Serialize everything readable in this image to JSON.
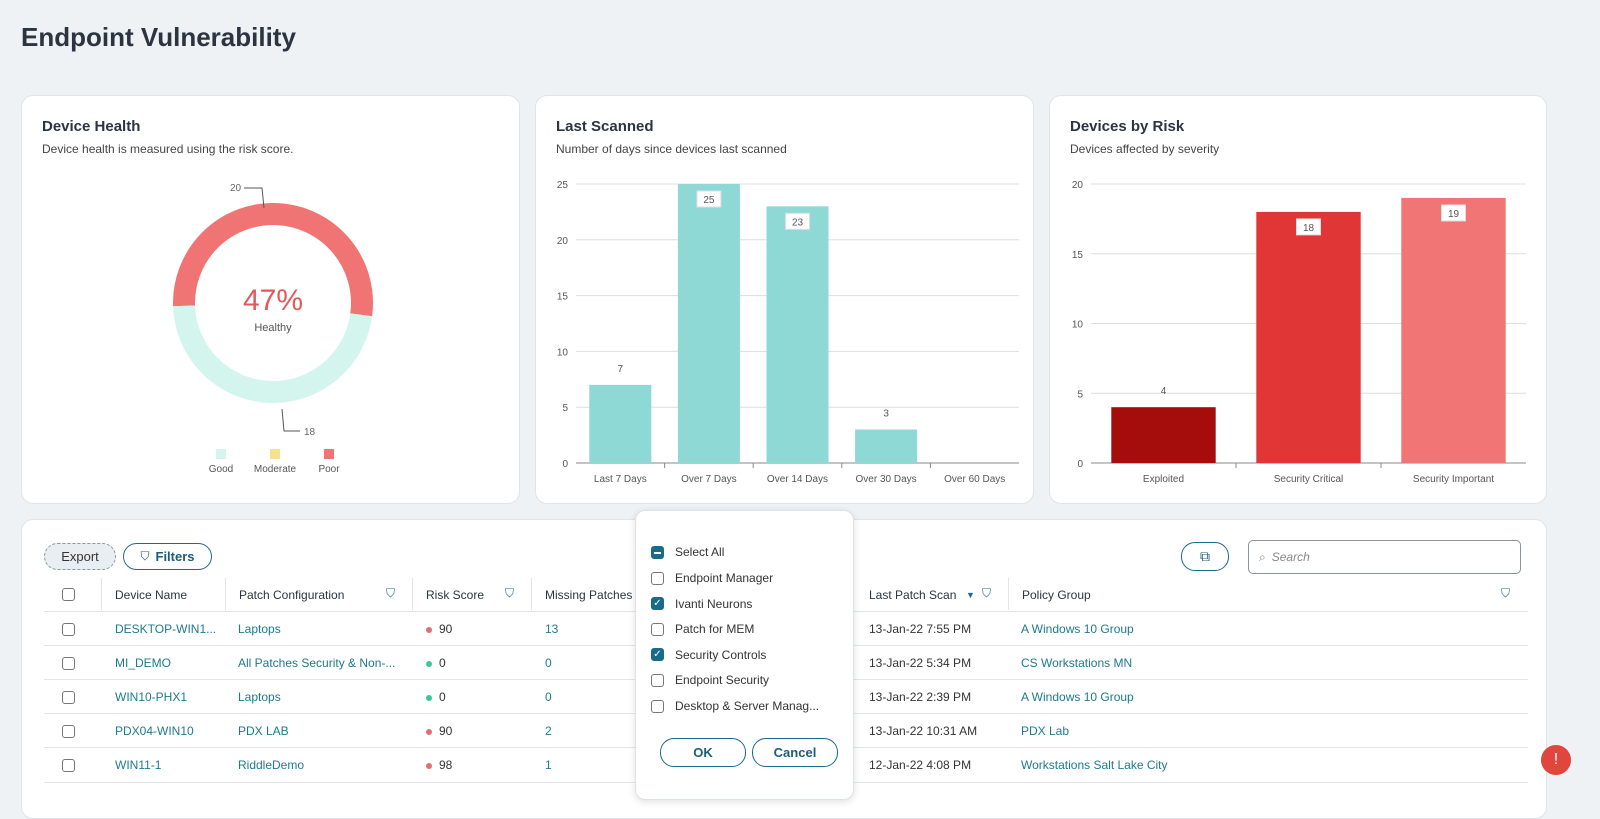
{
  "page": {
    "title": "Endpoint Vulnerability"
  },
  "device_health": {
    "title": "Device Health",
    "subtitle": "Device health is measured using the risk score.",
    "center_value": "47%",
    "center_label": "Healthy",
    "legend": [
      "Good",
      "Moderate",
      "Poor"
    ],
    "colors": {
      "Good": "#d4f5ee",
      "Moderate": "#f7e08c",
      "Poor": "#f07474"
    }
  },
  "last_scanned": {
    "title": "Last Scanned",
    "subtitle": "Number of days since devices last scanned"
  },
  "devices_by_risk": {
    "title": "Devices by Risk",
    "subtitle": "Devices affected by severity"
  },
  "chart_data": [
    {
      "type": "pie",
      "slices": [
        {
          "label": "Good",
          "value": 18
        },
        {
          "label": "Moderate",
          "value": 0
        },
        {
          "label": "Poor",
          "value": 20
        }
      ]
    },
    {
      "type": "bar",
      "categories": [
        "Last 7 Days",
        "Over 7 Days",
        "Over 14 Days",
        "Over 30 Days",
        "Over 60 Days"
      ],
      "values": [
        7,
        25,
        23,
        3,
        0
      ],
      "ylim": [
        0,
        25
      ],
      "yticks": [
        0,
        5,
        10,
        15,
        20,
        25
      ],
      "grid": true,
      "color": "#8ed9d6"
    },
    {
      "type": "bar",
      "categories": [
        "Exploited",
        "Security Critical",
        "Security Important"
      ],
      "values": [
        4,
        18,
        19
      ],
      "ylim": [
        0,
        20
      ],
      "yticks": [
        0,
        5,
        10,
        15,
        20
      ],
      "grid": true,
      "colors": [
        "#a50d0d",
        "#e03636",
        "#f27575"
      ]
    }
  ],
  "toolbar": {
    "export": "Export",
    "filters": "Filters",
    "search_placeholder": "Search"
  },
  "table": {
    "headers": {
      "device": "Device Name",
      "patch": "Patch Configuration",
      "risk": "Risk Score",
      "missing": "Missing Patches",
      "scan": "Last Patch Scan",
      "policy": "Policy Group"
    },
    "rows": [
      {
        "device": "DESKTOP-WIN1...",
        "patch": "Laptops",
        "risk": "90",
        "risk_level": "high",
        "missing": "13",
        "scan": "13-Jan-22 7:55 PM",
        "policy": "A Windows 10 Group"
      },
      {
        "device": "MI_DEMO",
        "patch": "All Patches Security & Non-...",
        "risk": "0",
        "risk_level": "low",
        "missing": "0",
        "scan": "13-Jan-22 5:34 PM",
        "policy": "CS Workstations MN"
      },
      {
        "device": "WIN10-PHX1",
        "patch": "Laptops",
        "risk": "0",
        "risk_level": "low",
        "missing": "0",
        "scan": "13-Jan-22 2:39 PM",
        "policy": "A Windows 10 Group"
      },
      {
        "device": "PDX04-WIN10",
        "patch": "PDX LAB",
        "risk": "90",
        "risk_level": "high",
        "missing": "2",
        "scan": "13-Jan-22 10:31 AM",
        "policy": "PDX Lab"
      },
      {
        "device": "WIN11-1",
        "patch": "RiddleDemo",
        "risk": "98",
        "risk_level": "high",
        "missing": "1",
        "scan": "12-Jan-22 4:08 PM",
        "policy": "Workstations Salt Lake City"
      }
    ]
  },
  "filter_dropdown": {
    "select_all": "Select All",
    "options": [
      {
        "label": "Endpoint Manager",
        "checked": false
      },
      {
        "label": "Ivanti Neurons",
        "checked": true
      },
      {
        "label": "Patch for MEM",
        "checked": false
      },
      {
        "label": "Security Controls",
        "checked": true
      },
      {
        "label": "Endpoint Security",
        "checked": false
      },
      {
        "label": "Desktop & Server Manag...",
        "checked": false
      }
    ],
    "ok": "OK",
    "cancel": "Cancel"
  }
}
